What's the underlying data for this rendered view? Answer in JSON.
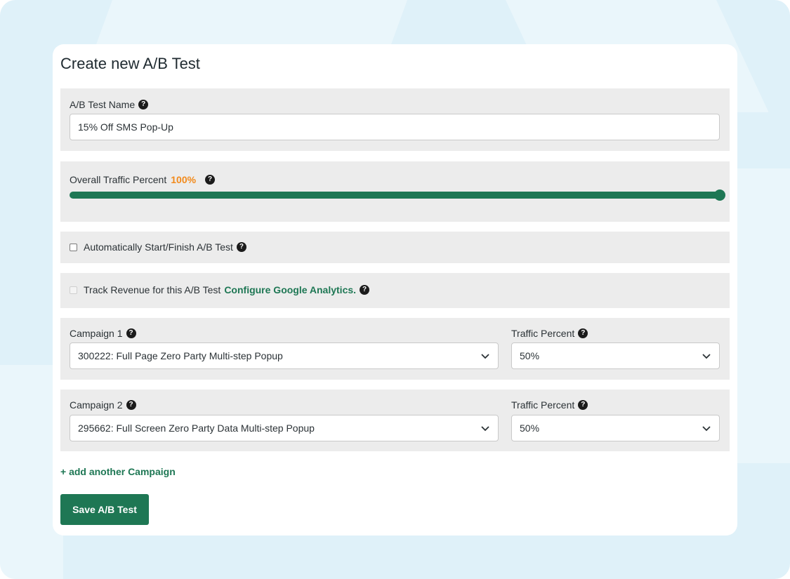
{
  "form": {
    "title": "Create new A/B Test",
    "help_glyph": "?",
    "name_section": {
      "label": "A/B Test Name",
      "value": "15% Off SMS Pop-Up"
    },
    "traffic_section": {
      "label": "Overall Traffic Percent",
      "percent_text": "100%",
      "slider_value_percent": 100
    },
    "auto_section": {
      "label": "Automatically Start/Finish A/B Test",
      "checked": false
    },
    "revenue_section": {
      "label": "Track Revenue for this A/B Test",
      "link": "Configure Google Analytics.",
      "checked": false,
      "disabled": true
    },
    "campaigns": [
      {
        "label": "Campaign 1",
        "selected": "300222: Full Page Zero Party Multi-step Popup",
        "traffic_label": "Traffic Percent",
        "traffic_value": "50%"
      },
      {
        "label": "Campaign 2",
        "selected": "295662: Full Screen Zero Party Data Multi-step Popup",
        "traffic_label": "Traffic Percent",
        "traffic_value": "50%"
      }
    ],
    "add_campaign": "+ add another Campaign",
    "save_button": "Save A/B Test"
  },
  "colors": {
    "accent": "#1e7754",
    "percent": "#f28a1b",
    "section_bg": "#ececec",
    "backdrop": "#dff1f9"
  }
}
